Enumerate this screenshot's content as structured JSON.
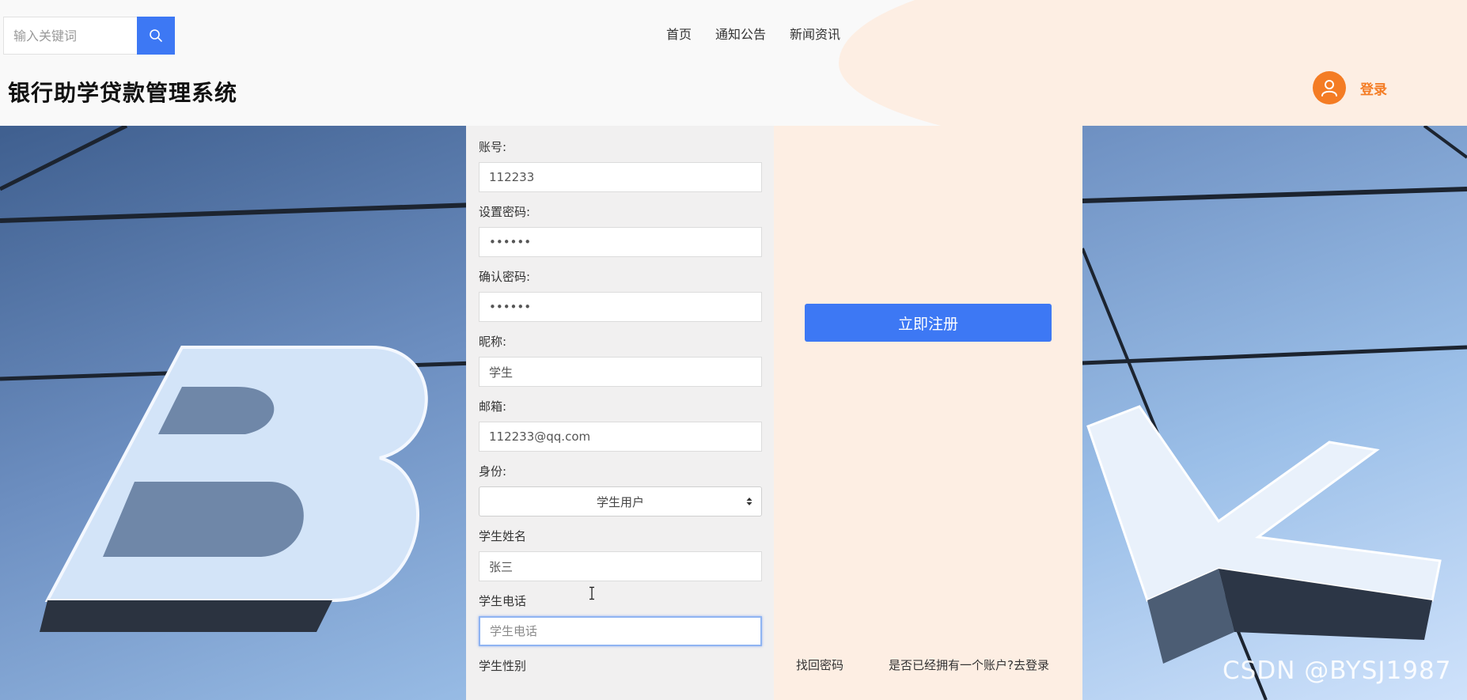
{
  "header": {
    "search": {
      "placeholder": "输入关键词"
    },
    "nav": [
      "首页",
      "通知公告",
      "新闻资讯"
    ],
    "site_title": "银行助学贷款管理系统",
    "login_label": "登录"
  },
  "form": {
    "account": {
      "label": "账号:",
      "value": "112233"
    },
    "password": {
      "label": "设置密码:",
      "value": "••••••"
    },
    "confirm_password": {
      "label": "确认密码:",
      "value": "••••••"
    },
    "nickname": {
      "label": "昵称:",
      "value": "学生"
    },
    "email": {
      "label": "邮箱:",
      "value": "112233@qq.com"
    },
    "role": {
      "label": "身份:",
      "selected": "学生用户"
    },
    "student_name": {
      "label": "学生姓名",
      "value": "张三"
    },
    "student_phone": {
      "label": "学生电话",
      "placeholder": "学生电话",
      "value": ""
    },
    "student_gender": {
      "label": "学生性别"
    }
  },
  "actions": {
    "register": "立即注册",
    "find_password": "找回密码",
    "goto_login": "是否已经拥有一个账户?去登录"
  },
  "watermark": "CSDN @BYSJ1987",
  "colors": {
    "primary": "#3d78f4",
    "accent": "#f47c24",
    "panel_left": "#f1f0f0",
    "panel_right": "#fdeee3"
  },
  "icons": {
    "search": "search-icon",
    "avatar": "user-icon",
    "select": "sort-arrows-icon"
  }
}
